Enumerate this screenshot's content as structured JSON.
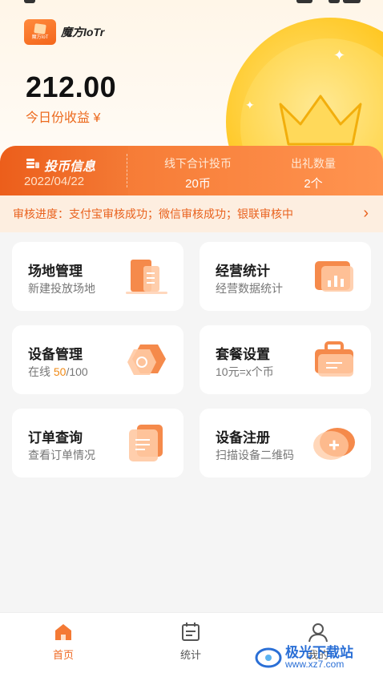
{
  "app": {
    "logo_mini": "魔方IoT",
    "logo_text": "魔方IoTr"
  },
  "earnings": {
    "amount": "212.00",
    "label": "今日份收益 ¥"
  },
  "coin_info": {
    "title": "投币信息",
    "date": "2022/04/22",
    "offline_label": "线下合计投币",
    "offline_value": "20币",
    "gift_label": "出礼数量",
    "gift_value": "2个"
  },
  "audit": {
    "text": "审核进度：支付宝审核成功；微信审核成功；银联审核中",
    "chevron": "›"
  },
  "cards": [
    {
      "title": "场地管理",
      "subtitle": "新建投放场地",
      "icon": "building-icon"
    },
    {
      "title": "经营统计",
      "subtitle": "经营数据统计",
      "icon": "bar-chart-icon"
    },
    {
      "title": "设备管理",
      "subtitle_prefix": "在线 ",
      "subtitle_highlight": "50",
      "subtitle_suffix": "/100",
      "icon": "hexagon-device-icon"
    },
    {
      "title": "套餐设置",
      "subtitle": "10元=x个币",
      "icon": "briefcase-icon"
    },
    {
      "title": "订单查询",
      "subtitle": "查看订单情况",
      "icon": "document-icon"
    },
    {
      "title": "设备注册",
      "subtitle": "扫描设备二维码",
      "icon": "add-circle-icon"
    }
  ],
  "tabs": [
    {
      "label": "首页",
      "icon": "home-icon",
      "active": true
    },
    {
      "label": "统计",
      "icon": "calendar-stats-icon",
      "active": false
    },
    {
      "label": "我的",
      "icon": "user-icon",
      "active": false
    }
  ],
  "watermark": {
    "name": "极光下载站",
    "url": "www.xz7.com"
  },
  "colors": {
    "accent": "#ef6a23",
    "highlight": "#f08a16",
    "audit_bg": "#fdeee0",
    "coin": "#ffc61e"
  }
}
